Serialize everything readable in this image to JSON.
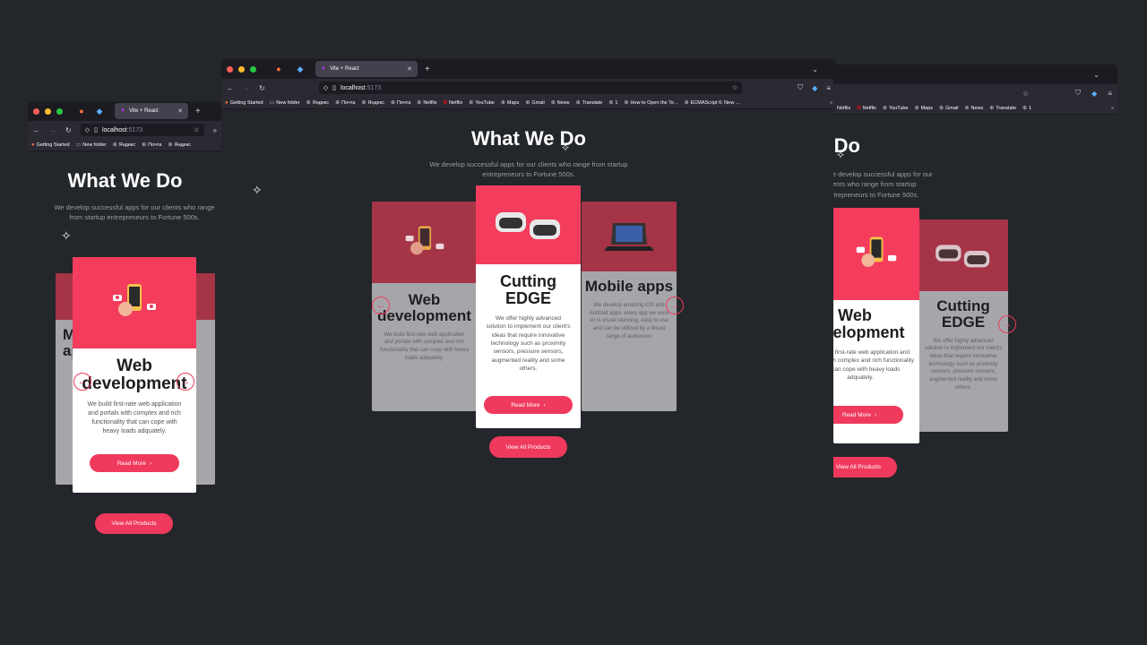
{
  "browser": {
    "tab_title": "Vite + React",
    "url_host": "localhost",
    "url_port": ":5173",
    "bookmarks": [
      "Getting Started",
      "New folder",
      "Яндекс",
      "Почта",
      "Яндекс",
      "Почта",
      "Netflix",
      "Netflix",
      "YouTube",
      "Maps",
      "Gmail",
      "News",
      "Translate",
      "1",
      "How to Open the Te...",
      "ECMAScript 6: New ..."
    ],
    "bookmarks_right": [
      "Netflix",
      "Netflix",
      "YouTube",
      "Maps",
      "Gmail",
      "News",
      "Translate",
      "1"
    ]
  },
  "page": {
    "heading": "What We Do",
    "subtitle": "We develop successful apps for our clients who range from startup entrepreneurs to Fortune 500s.",
    "view_all": "View All Products",
    "read_more": "Read More"
  },
  "cards": {
    "web": {
      "title": "Web development",
      "desc": "We build first-rate web application and portals with complex and rich functionality that can cope with heavy loads adquately."
    },
    "edge": {
      "title": "Cutting EDGE",
      "desc": "We offer highly advanced solution to implement our client's ideas that require innovative technology such as proximity sensors, pressure sensors, augmented reality and some others."
    },
    "mobile": {
      "title": "Mobile apps",
      "desc": "We develop amazing iOS and Android apps. every app we work on is visual stunning, easy to use and can be utilized by a broad range of audiences"
    }
  },
  "colors": {
    "accent": "#ef3a5d",
    "background": "#24272a",
    "card_faded": "#a6a6aa"
  }
}
